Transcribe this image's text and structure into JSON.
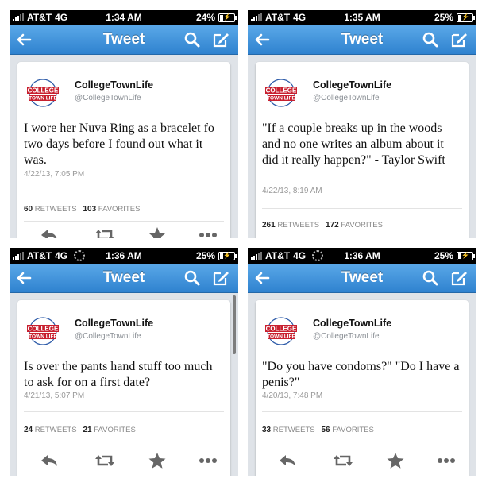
{
  "screens": [
    {
      "carrier": "AT&T",
      "network": "4G",
      "time": "1:34 AM",
      "battery": "24%",
      "battery_level": 0.24,
      "nav_title": "Tweet",
      "user_name": "CollegeTownLife",
      "handle": "@CollegeTownLife",
      "logo_text": [
        "COLLEGE",
        "TOWN LIFE"
      ],
      "tweet": "I wore her Nuva Ring as a bracelet fo two days before I found out what it was.",
      "date": "4/22/13, 7:05 PM",
      "retweets": "60",
      "retweets_label": "RETWEETS",
      "favorites": "103",
      "favorites_label": "FAVORITES"
    },
    {
      "carrier": "AT&T",
      "network": "4G",
      "time": "1:35 AM",
      "battery": "25%",
      "battery_level": 0.25,
      "nav_title": "Tweet",
      "user_name": "CollegeTownLife",
      "handle": "@CollegeTownLife",
      "logo_text": [
        "COLLEGE",
        "TOWN LIFE"
      ],
      "tweet": "\"If a couple breaks up in the woods and no one writes an album about it did it really happen?\" - Taylor Swift",
      "date": "4/22/13, 8:19 AM",
      "retweets": "261",
      "retweets_label": "RETWEETS",
      "favorites": "172",
      "favorites_label": "FAVORITES"
    },
    {
      "carrier": "AT&T",
      "network": "4G",
      "time": "1:36 AM",
      "battery": "25%",
      "battery_level": 0.25,
      "nav_title": "Tweet",
      "user_name": "CollegeTownLife",
      "handle": "@CollegeTownLife",
      "logo_text": [
        "COLLEGE",
        "TOWN LIFE"
      ],
      "tweet": "Is over the pants hand stuff too much to ask for on a first date?",
      "date": "4/21/13, 5:07 PM",
      "retweets": "24",
      "retweets_label": "RETWEETS",
      "favorites": "21",
      "favorites_label": "FAVORITES"
    },
    {
      "carrier": "AT&T",
      "network": "4G",
      "time": "1:36 AM",
      "battery": "25%",
      "battery_level": 0.25,
      "nav_title": "Tweet",
      "user_name": "CollegeTownLife",
      "handle": "@CollegeTownLife",
      "logo_text": [
        "COLLEGE",
        "TOWN LIFE"
      ],
      "tweet": "\"Do you have condoms?\" \"Do I have a penis?\"",
      "date": "4/20/13, 7:48 PM",
      "retweets": "33",
      "retweets_label": "RETWEETS",
      "favorites": "56",
      "favorites_label": "FAVORITES"
    }
  ],
  "icons": {
    "nav": [
      "back-arrow-icon",
      "search-icon",
      "compose-icon"
    ],
    "actions": [
      "reply-icon",
      "retweet-icon",
      "favorite-star-icon",
      "more-icon"
    ]
  },
  "colors": {
    "navbar": "#3a8ed8",
    "status_bar": "#000000",
    "logo_red": "#c8202f",
    "logo_blue": "#2c5aa8",
    "icon_gray": "#666666"
  }
}
